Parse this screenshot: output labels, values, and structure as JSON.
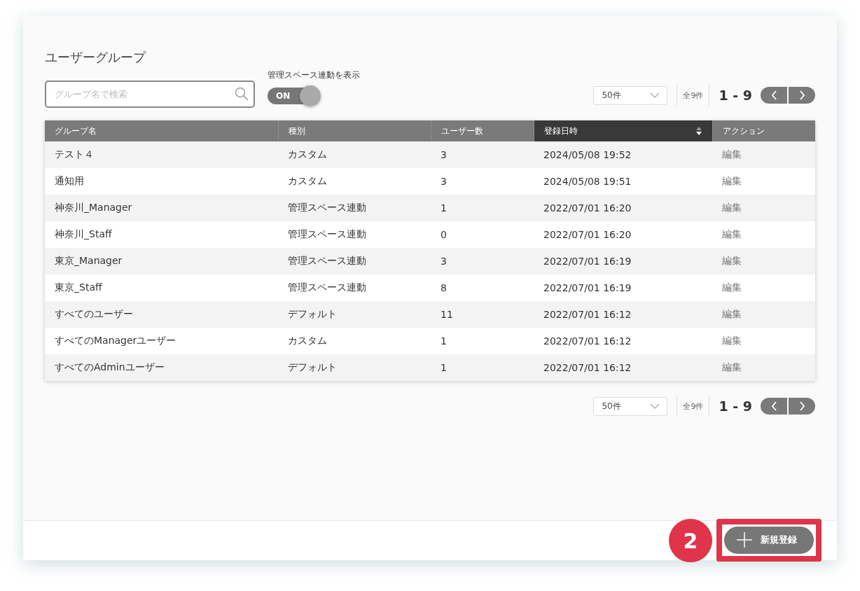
{
  "title": "ユーザーグループ",
  "search": {
    "placeholder": "グループ名で検索"
  },
  "toggle": {
    "label": "管理スペース連動を表示",
    "text": "ON",
    "on": true
  },
  "pagers": [
    {
      "page_size": "50件",
      "total": "全9件",
      "range": "1 - 9"
    },
    {
      "page_size": "50件",
      "total": "全9件",
      "range": "1 - 9"
    }
  ],
  "table": {
    "columns": [
      {
        "label": "グループ名",
        "sorted": false
      },
      {
        "label": "種別",
        "sorted": false
      },
      {
        "label": "ユーザー数",
        "sorted": false
      },
      {
        "label": "登録日時",
        "sorted": true
      },
      {
        "label": "アクション",
        "sorted": false
      }
    ],
    "rows": [
      [
        "テスト４",
        "カスタム",
        "3",
        "2024/05/08 19:52",
        "編集"
      ],
      [
        "通知用",
        "カスタム",
        "3",
        "2024/05/08 19:51",
        "編集"
      ],
      [
        "神奈川_Manager",
        "管理スペース連動",
        "1",
        "2022/07/01 16:20",
        "編集"
      ],
      [
        "神奈川_Staff",
        "管理スペース連動",
        "0",
        "2022/07/01 16:20",
        "編集"
      ],
      [
        "東京_Manager",
        "管理スペース連動",
        "3",
        "2022/07/01 16:19",
        "編集"
      ],
      [
        "東京_Staff",
        "管理スペース連動",
        "8",
        "2022/07/01 16:19",
        "編集"
      ],
      [
        "すべてのユーザー",
        "デフォルト",
        "11",
        "2022/07/01 16:12",
        "編集"
      ],
      [
        "すべてのManagerユーザー",
        "カスタム",
        "1",
        "2022/07/01 16:12",
        "編集"
      ],
      [
        "すべてのAdminユーザー",
        "デフォルト",
        "1",
        "2022/07/01 16:12",
        "編集"
      ]
    ]
  },
  "footer": {
    "step": "2",
    "button": "新規登録",
    "highlighted": true
  }
}
